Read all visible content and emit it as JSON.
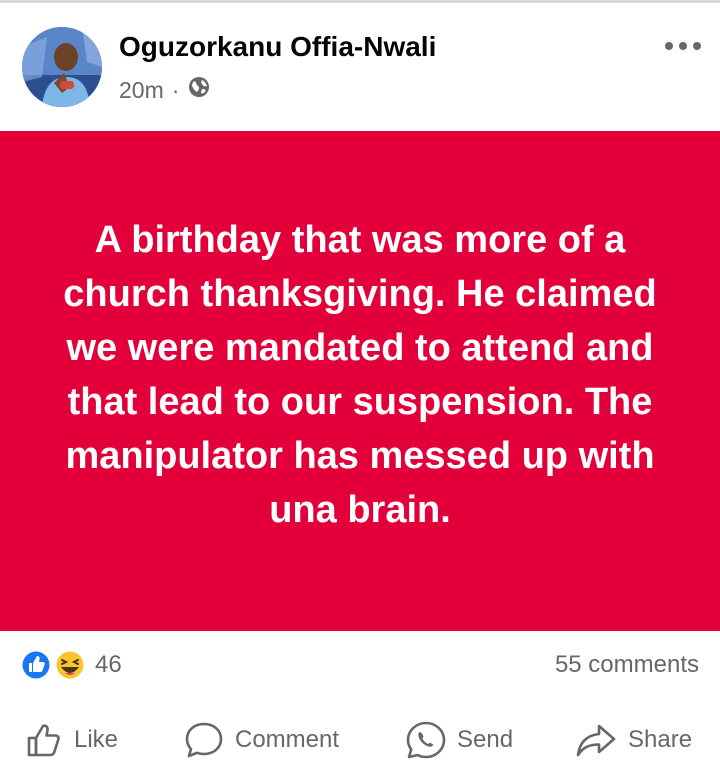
{
  "post": {
    "author": "Oguzorkanu Offia-Nwali",
    "time": "20m",
    "separator": "·",
    "privacy_icon": "globe-icon",
    "more_icon": "more-icon",
    "text": "A birthday that was more of a church thanksgiving. He claimed we were mandated to attend and that lead to our suspension. The manipulator has messed up with una brain.",
    "background_color": "#e3003a"
  },
  "reactions": {
    "icons": [
      "like-reaction-icon",
      "haha-reaction-icon"
    ],
    "count": "46",
    "comments": "55 comments"
  },
  "actions": {
    "like": "Like",
    "comment": "Comment",
    "send": "Send",
    "share": "Share"
  }
}
